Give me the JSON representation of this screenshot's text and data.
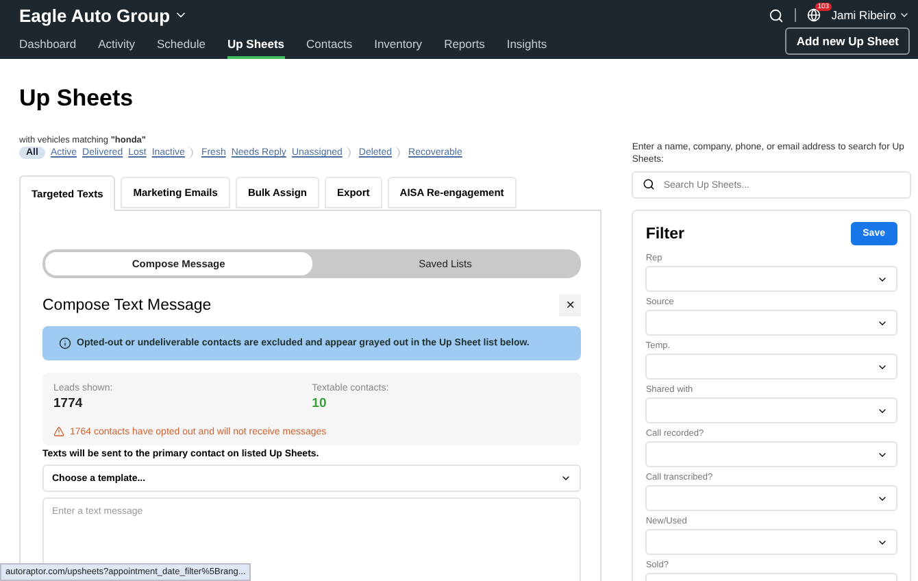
{
  "header": {
    "brand": "Eagle Auto Group",
    "notification_count": "103",
    "user": "Jami Ribeiro",
    "add_button": "Add new Up Sheet"
  },
  "nav": [
    {
      "label": "Dashboard",
      "selected": false
    },
    {
      "label": "Activity",
      "selected": false
    },
    {
      "label": "Schedule",
      "selected": false
    },
    {
      "label": "Up Sheets",
      "selected": true
    },
    {
      "label": "Contacts",
      "selected": false
    },
    {
      "label": "Inventory",
      "selected": false
    },
    {
      "label": "Reports",
      "selected": false
    },
    {
      "label": "Insights",
      "selected": false
    }
  ],
  "page": {
    "title": "Up Sheets",
    "subtitle": "with vehicles matching **\"honda\"**"
  },
  "status_filters": [
    {
      "label": "All",
      "selected": true,
      "group_end": false
    },
    {
      "label": "Active",
      "selected": false,
      "group_end": false
    },
    {
      "label": "Delivered",
      "selected": false,
      "group_end": false
    },
    {
      "label": "Lost",
      "selected": false,
      "group_end": false
    },
    {
      "label": "Inactive",
      "selected": false,
      "group_end": true
    },
    {
      "label": "Fresh",
      "selected": false,
      "group_end": false
    },
    {
      "label": "Needs Reply",
      "selected": false,
      "group_end": false
    },
    {
      "label": "Unassigned",
      "selected": false,
      "group_end": true
    },
    {
      "label": "Deleted",
      "selected": false,
      "group_end": true
    },
    {
      "label": "Recoverable",
      "selected": false,
      "group_end": false
    }
  ],
  "tabs": [
    {
      "label": "Targeted Texts",
      "selected": true
    },
    {
      "label": "Marketing Emails",
      "selected": false
    },
    {
      "label": "Bulk Assign",
      "selected": false
    },
    {
      "label": "Export",
      "selected": false
    },
    {
      "label": "AISA Re-engagement",
      "selected": false
    }
  ],
  "segments": [
    {
      "label": "Compose Message",
      "selected": true
    },
    {
      "label": "Saved Lists",
      "selected": false
    }
  ],
  "compose": {
    "title": "Compose Text Message",
    "close": "×",
    "info": "Opted-out or undeliverable contacts are excluded and appear grayed out in the Up Sheet list below.",
    "stats": [
      {
        "label": "Leads shown:",
        "value": "1774",
        "kind": "plain"
      },
      {
        "label": "Textable contacts:",
        "value": "10",
        "kind": "good"
      }
    ],
    "warning": "1764 contacts have opted out and will not receive messages",
    "recipients_note": "Texts will be sent to the primary contact on listed Up Sheets.",
    "template": {
      "value": "Choose a template..."
    },
    "message": {
      "placeholder": "Enter a text message"
    }
  },
  "search": {
    "help": "Enter a name, company, phone, or email address to search for Up Sheets:",
    "placeholder": "Search Up Sheets..."
  },
  "filter": {
    "title": "Filter",
    "save": "Save",
    "fields": [
      {
        "label": "Rep"
      },
      {
        "label": "Source"
      },
      {
        "label": "Temp."
      },
      {
        "label": "Shared with"
      },
      {
        "label": "Call recorded?"
      },
      {
        "label": "Call transcribed?"
      },
      {
        "label": "New/Used"
      },
      {
        "label": "Sold?"
      }
    ]
  },
  "status_url": "autoraptor.com/upsheets?appointment_date_filter%5Brang..."
}
